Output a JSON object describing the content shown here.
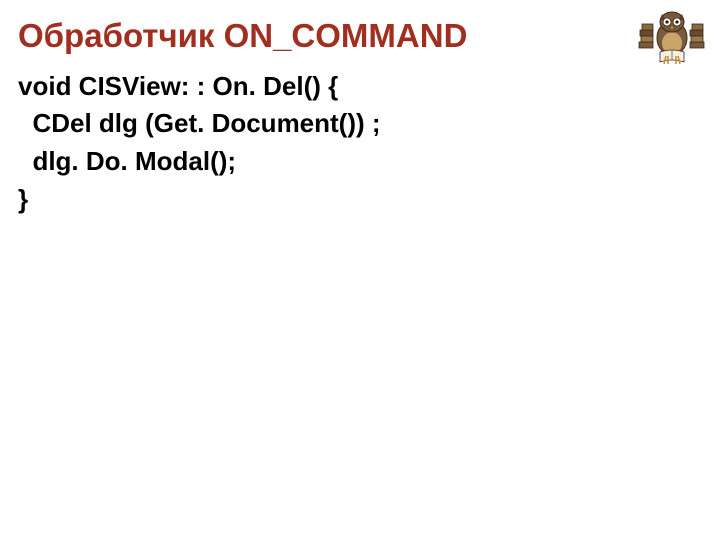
{
  "heading": "Обработчик ON_COMMAND",
  "code": {
    "line1": "void CISView: : On. Del() {",
    "line2": "  CDel dlg (Get. Document()) ;",
    "line3": "  dlg. Do. Modal();",
    "line4": "}"
  },
  "icon": {
    "name": "owl-books-icon"
  }
}
